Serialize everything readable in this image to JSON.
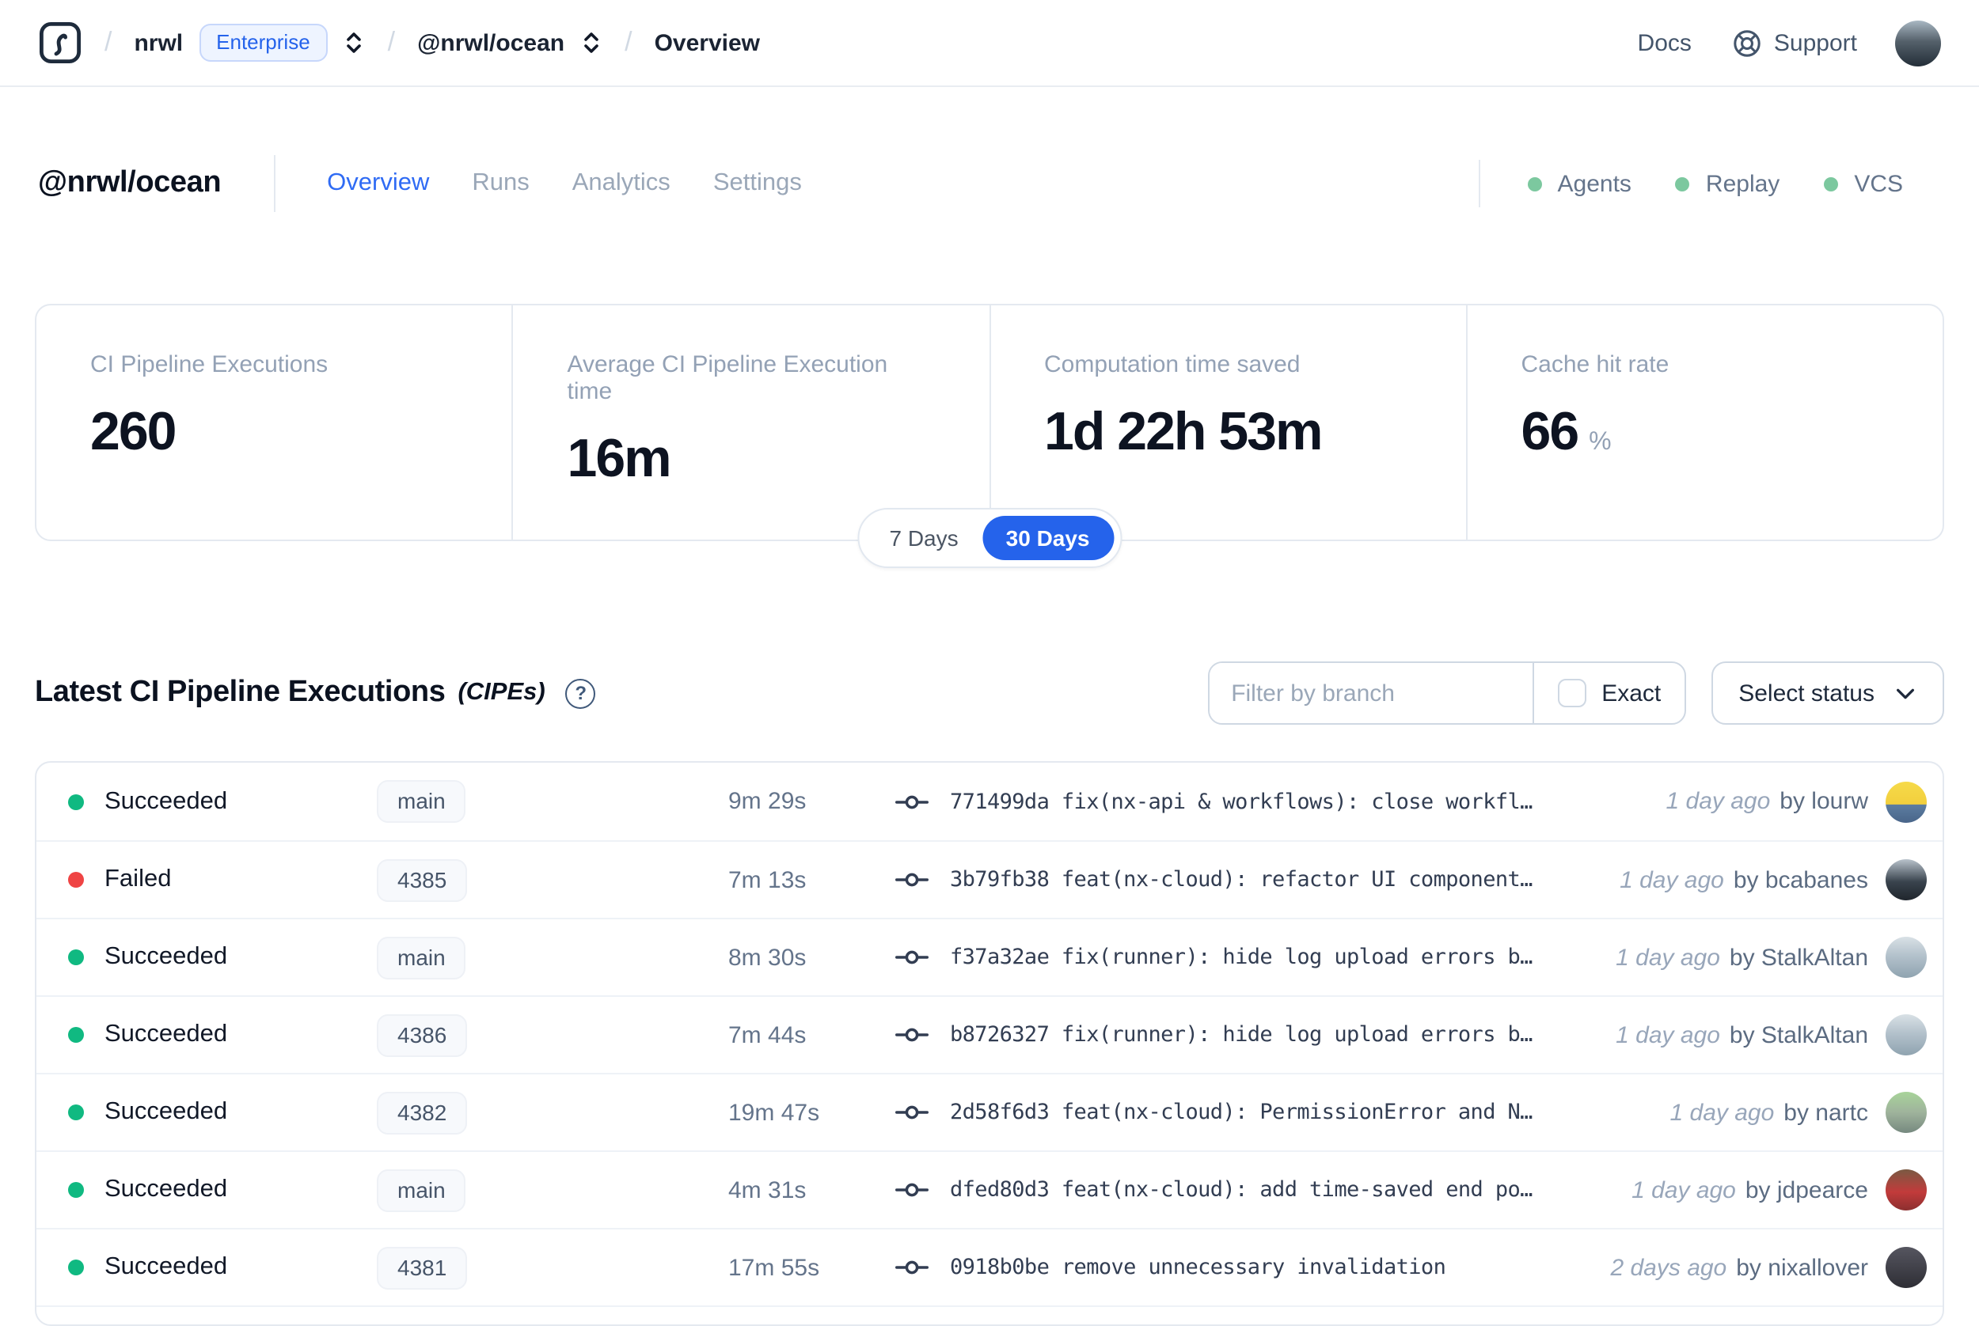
{
  "navbar": {
    "separator": "/",
    "org": "nrwl",
    "org_badge": "Enterprise",
    "workspace": "@nrwl/ocean",
    "page": "Overview",
    "docs_label": "Docs",
    "support_label": "Support",
    "avatar_bg": "linear-gradient(180deg,#a9b8c3 0%,#55616b 45%,#232e38 100%)"
  },
  "header": {
    "title": "@nrwl/ocean",
    "tabs": [
      {
        "label": "Overview",
        "active": true
      },
      {
        "label": "Runs",
        "active": false
      },
      {
        "label": "Analytics",
        "active": false
      },
      {
        "label": "Settings",
        "active": false
      }
    ],
    "indicators": [
      {
        "label": "Agents"
      },
      {
        "label": "Replay"
      },
      {
        "label": "VCS"
      }
    ],
    "indicator_color": "#7cc89f",
    "active_tab_color": "#2f6bf4"
  },
  "stats": {
    "cards": [
      {
        "label": "CI Pipeline Executions",
        "value": "260",
        "unit": ""
      },
      {
        "label": "Average CI Pipeline Execution time",
        "value": "16m",
        "unit": ""
      },
      {
        "label": "Computation time saved",
        "value": "1d 22h 53m",
        "unit": ""
      },
      {
        "label": "Cache hit rate",
        "value": "66",
        "unit": "%"
      }
    ],
    "range_toggle": {
      "options": [
        "7 Days",
        "30 Days"
      ],
      "selected": "30 Days",
      "active_color": "#2563eb"
    }
  },
  "cipes": {
    "title": "Latest CI Pipeline Executions",
    "title_suffix": "(CIPEs)",
    "help_icon": "?",
    "filter": {
      "placeholder": "Filter by branch",
      "exact_label": "Exact",
      "exact_checked": false,
      "status_button_label": "Select status"
    },
    "status_colors": {
      "succeeded": "#10b981",
      "failed": "#ef4444"
    },
    "rows": [
      {
        "status": "Succeeded",
        "status_color": "#10b981",
        "branch": "main",
        "duration": "9m 29s",
        "commit_hash": "771499da",
        "commit_message": "fix(nx-api & workflows): close workfl…",
        "time": "1 day ago",
        "author": "by lourw",
        "avatar_bg": "linear-gradient(180deg,#f6da4a 0%,#f2cf3d 55%,#5c7da0 56%,#49658a 100%)"
      },
      {
        "status": "Failed",
        "status_color": "#ef4444",
        "branch": "4385",
        "duration": "7m 13s",
        "commit_hash": "3b79fb38",
        "commit_message": "feat(nx-cloud): refactor UI component…",
        "time": "1 day ago",
        "author": "by bcabanes",
        "avatar_bg": "linear-gradient(180deg,#b9c3cc 0%,#39434d 55%,#20262d 100%)"
      },
      {
        "status": "Succeeded",
        "status_color": "#10b981",
        "branch": "main",
        "duration": "8m 30s",
        "commit_hash": "f37a32ae",
        "commit_message": "fix(runner): hide log upload errors b…",
        "time": "1 day ago",
        "author": "by StalkAltan",
        "avatar_bg": "linear-gradient(180deg,#d9e1e6 0%,#b4c2cc 45%,#8fa3b0 100%)"
      },
      {
        "status": "Succeeded",
        "status_color": "#10b981",
        "branch": "4386",
        "duration": "7m 44s",
        "commit_hash": "b8726327",
        "commit_message": "fix(runner): hide log upload errors b…",
        "time": "1 day ago",
        "author": "by StalkAltan",
        "avatar_bg": "linear-gradient(180deg,#d9e1e6 0%,#b4c2cc 45%,#8fa3b0 100%)"
      },
      {
        "status": "Succeeded",
        "status_color": "#10b981",
        "branch": "4382",
        "duration": "19m 47s",
        "commit_hash": "2d58f6d3",
        "commit_message": "feat(nx-cloud): PermissionError and N…",
        "time": "1 day ago",
        "author": "by nartc",
        "avatar_bg": "linear-gradient(180deg,#a8d49a 0%,#9fb39c 50%,#76897f 100%)"
      },
      {
        "status": "Succeeded",
        "status_color": "#10b981",
        "branch": "main",
        "duration": "4m 31s",
        "commit_hash": "dfed80d3",
        "commit_message": "feat(nx-cloud): add time-saved end po…",
        "time": "1 day ago",
        "author": "by jdpearce",
        "avatar_bg": "linear-gradient(180deg,#7a5a43 0%,#c23b3b 55%,#8c2f2f 100%)"
      },
      {
        "status": "Succeeded",
        "status_color": "#10b981",
        "branch": "4381",
        "duration": "17m 55s",
        "commit_hash": "0918b0be",
        "commit_message": "remove unnecessary invalidation",
        "time": "2 days ago",
        "author": "by nixallover",
        "avatar_bg": "linear-gradient(180deg,#565660 0%,#2e2e35 100%)"
      }
    ]
  }
}
